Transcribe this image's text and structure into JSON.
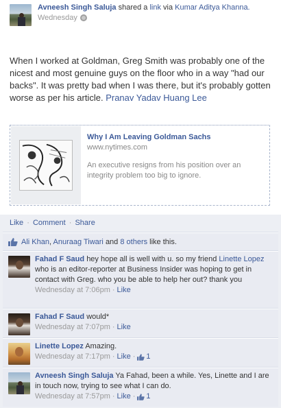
{
  "post": {
    "author": "Avneesh Singh Saluja",
    "action_pre": "shared a",
    "link_word": "link",
    "action_via": "via",
    "via_name": "Kumar Aditya Khanna.",
    "time": "Wednesday",
    "body": "When I worked at Goldman, Greg Smith was probably one of the nicest and most genuine guys on the floor who in a way \"had our backs\". It was pretty bad when I was there, but it's probably gotten worse as per his article.",
    "tagged": "Pranav Yadav Huang Lee"
  },
  "attachment": {
    "title": "Why I Am Leaving Goldman Sachs",
    "domain": "www.nytimes.com",
    "description": "An executive resigns from his position over an integrity problem too big to ignore."
  },
  "actions": {
    "like": "Like",
    "comment": "Comment",
    "share": "Share"
  },
  "likes": {
    "name1": "Ali Khan",
    "name2": "Anuraag Tiwari",
    "and": "and",
    "others": "8 others",
    "suffix": "like this."
  },
  "comments": [
    {
      "author": "Fahad F Saud",
      "text_pre": "hey hope all is well with u. so my friend",
      "mention": "Linette Lopez",
      "text_post": "who is an editor-reporter at Business Insider was hoping to get in contact with Greg. who you be able to help her out? thank you",
      "time": "Wednesday at 7:06pm",
      "like": "Like"
    },
    {
      "author": "Fahad F Saud",
      "text": "would*",
      "time": "Wednesday at 7:07pm",
      "like": "Like"
    },
    {
      "author": "Linette Lopez",
      "text": "Amazing.",
      "time": "Wednesday at 7:17pm",
      "like": "Like",
      "like_count": "1"
    },
    {
      "author": "Avneesh Singh Saluja",
      "text": "Ya Fahad, been a while. Yes, Linette and I are in touch now, trying to see what I can do.",
      "time": "Wednesday at 7:57pm",
      "like": "Like",
      "like_count": "1"
    }
  ],
  "separators": {
    "dot": "·"
  },
  "colors": {
    "link": "#3b5998",
    "feedback_bg": "#edeff4",
    "muted": "#999999"
  },
  "icons": [
    "globe-icon",
    "thumbs-up-icon"
  ]
}
